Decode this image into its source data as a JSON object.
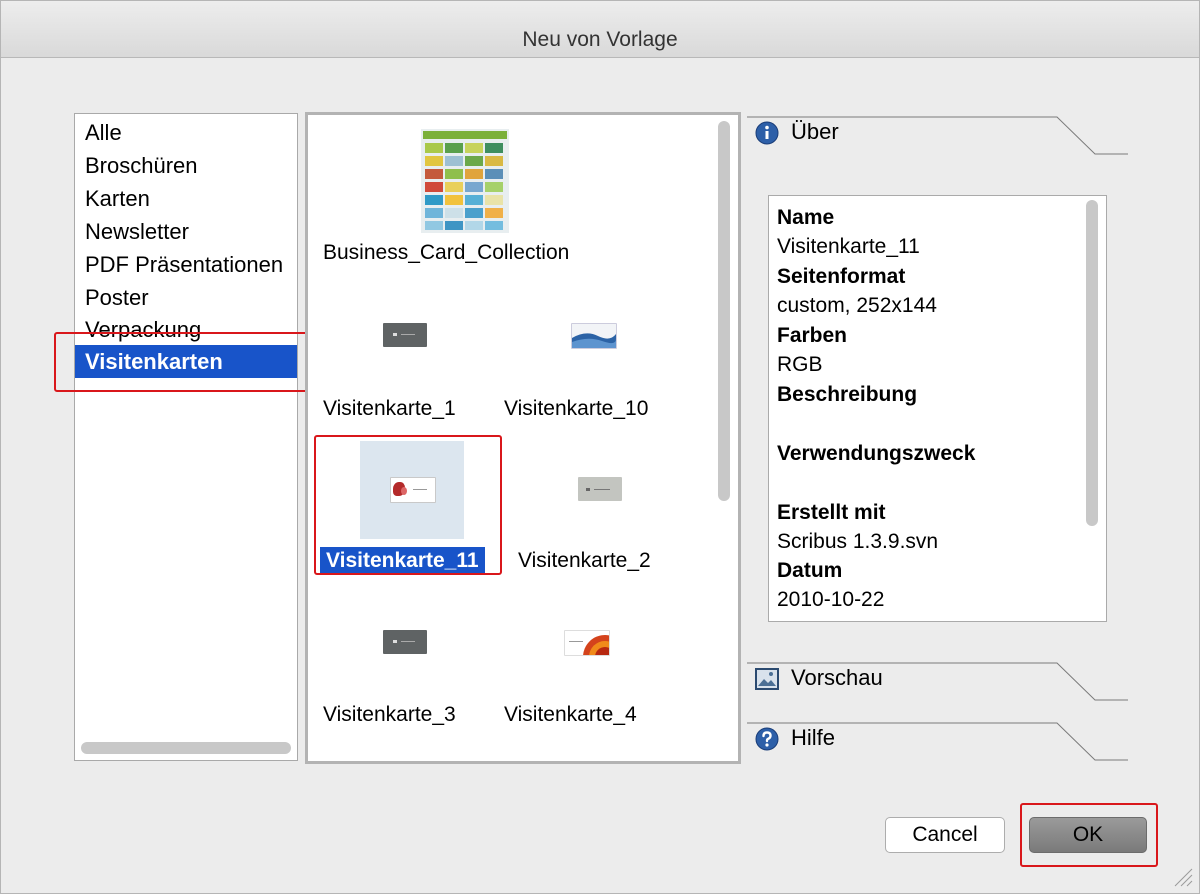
{
  "window": {
    "title": "Neu von Vorlage"
  },
  "categories": [
    {
      "label": "Alle",
      "selected": false
    },
    {
      "label": "Broschüren",
      "selected": false
    },
    {
      "label": "Karten",
      "selected": false
    },
    {
      "label": "Newsletter",
      "selected": false
    },
    {
      "label": "PDF Präsentationen",
      "selected": false
    },
    {
      "label": "Poster",
      "selected": false
    },
    {
      "label": "Verpackung",
      "selected": false
    },
    {
      "label": "Visitenkarten",
      "selected": true
    }
  ],
  "templates": [
    {
      "label": "Business_Card_Collection",
      "selected": false
    },
    {
      "label": "Visitenkarte_1",
      "selected": false
    },
    {
      "label": "Visitenkarte_10",
      "selected": false
    },
    {
      "label": "Visitenkarte_11",
      "selected": true
    },
    {
      "label": "Visitenkarte_2",
      "selected": false
    },
    {
      "label": "Visitenkarte_3",
      "selected": false
    },
    {
      "label": "Visitenkarte_4",
      "selected": false
    }
  ],
  "tabs": {
    "about": {
      "label": "Über",
      "icon": "info-icon"
    },
    "preview": {
      "label": "Vorschau",
      "icon": "image-icon"
    },
    "help": {
      "label": "Hilfe",
      "icon": "help-icon"
    }
  },
  "info": [
    {
      "text": "Name",
      "bold": true
    },
    {
      "text": "Visitenkarte_11",
      "bold": false
    },
    {
      "text": "Seitenformat",
      "bold": true
    },
    {
      "text": "custom, 252x144",
      "bold": false
    },
    {
      "text": "Farben",
      "bold": true
    },
    {
      "text": "RGB",
      "bold": false
    },
    {
      "text": "Beschreibung",
      "bold": true
    },
    {
      "text": "",
      "bold": false
    },
    {
      "text": "Verwendungszweck",
      "bold": true
    },
    {
      "text": "",
      "bold": false
    },
    {
      "text": "Erstellt mit",
      "bold": true
    },
    {
      "text": "Scribus 1.3.9.svn",
      "bold": false
    },
    {
      "text": "Datum",
      "bold": true
    },
    {
      "text": "2010-10-22",
      "bold": false
    }
  ],
  "buttons": {
    "cancel": "Cancel",
    "ok": "OK"
  },
  "colors": {
    "selection": "#1854c9",
    "highlight": "#d9171b"
  }
}
